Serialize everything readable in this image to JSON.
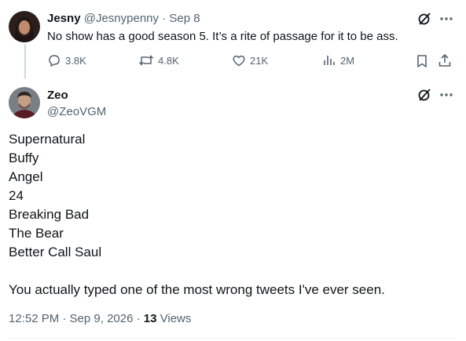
{
  "parent": {
    "name": "Jesny",
    "handle": "@Jesnypenny",
    "separator": "·",
    "date": "Sep 8",
    "text": "No show has a good season 5. It’s a rite of passage for it to be ass.",
    "replies": "3.8K",
    "retweets": "4.8K",
    "likes": "21K",
    "views": "2M"
  },
  "main": {
    "name": "Zeo",
    "handle": "@ZeoVGM",
    "lines": [
      "Supernatural",
      "Buffy",
      "Angel",
      "24",
      "Breaking Bad",
      "The Bear",
      "Better Call Saul"
    ],
    "closing": "You actually typed one of the most wrong tweets I've ever seen.",
    "meta": "12:52 PM · Sep 9, 2026 ·",
    "views_count": "13",
    "views_label": "Views"
  },
  "colors": {
    "text": "#0f1419",
    "secondary": "#536471",
    "border": "#eff3f4"
  }
}
